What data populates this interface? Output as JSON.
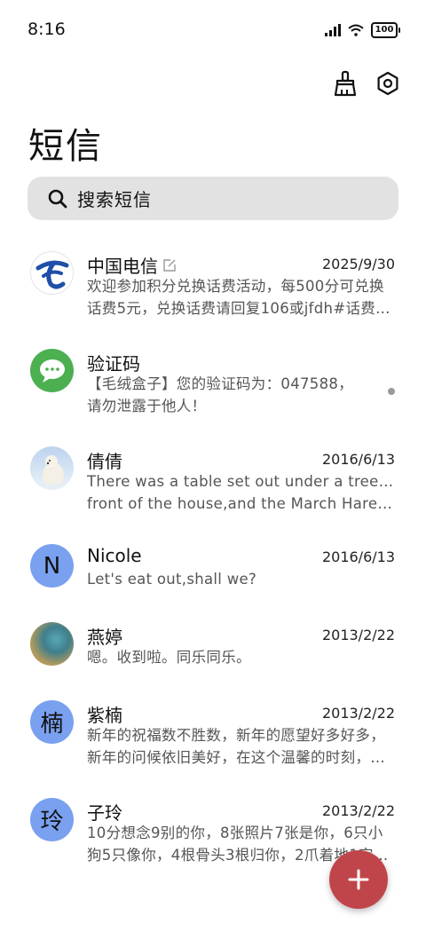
{
  "status_bar": {
    "time": "8:16",
    "battery": "100"
  },
  "header": {
    "title": "短信"
  },
  "search": {
    "placeholder": "搜索短信"
  },
  "conversations": [
    {
      "name": "中国电信",
      "date": "2025/9/30",
      "lines": [
        "欢迎参加积分兑换话费活动，每500分可兑换",
        "话费5元，兑换话费请回复106或jfdh#话费…"
      ],
      "avatar": "telecom-logo",
      "avatar_color": "#1f4fa8"
    },
    {
      "name": "验证码",
      "date": "",
      "lines": [
        "【毛绒盒子】您的验证码为：047588，",
        "请勿泄露于他人！"
      ],
      "avatar": "chat-bubble",
      "avatar_color": "#4caf50",
      "unread": true
    },
    {
      "name": "倩倩",
      "date": "2016/6/13",
      "lines": [
        "There was a table set out under a tree in",
        "front of the house,and the March Hare an…"
      ],
      "avatar": "polar-bear-photo"
    },
    {
      "name": "Nicole",
      "date": "2016/6/13",
      "lines": [
        "Let's eat out,shall we?"
      ],
      "avatar_letter": "N",
      "avatar_color": "#7aa0f0"
    },
    {
      "name": "燕婷",
      "date": "2013/2/22",
      "lines": [
        "嗯。收到啦。同乐同乐。"
      ],
      "avatar": "landscape-photo"
    },
    {
      "name": "紫楠",
      "date": "2013/2/22",
      "lines": [
        "新年的祝福数不胜数，新年的愿望好多好多，",
        "新年的问候依旧美好，在这个温馨的时刻，…"
      ],
      "avatar_letter": "楠",
      "avatar_color": "#7aa0f0"
    },
    {
      "name": "子玲",
      "date": "2013/2/22",
      "lines": [
        "10分想念9别的你，8张照片7张是你，6只小",
        "狗5只像你，4根骨头3根归你，2爪着地1定…"
      ],
      "avatar_letter": "玲",
      "avatar_color": "#7aa0f0"
    }
  ],
  "fab": {
    "icon": "plus-icon",
    "color": "#c0454a"
  },
  "icons": {
    "clean": "broom-icon",
    "settings": "settings-icon",
    "search": "search-icon"
  }
}
